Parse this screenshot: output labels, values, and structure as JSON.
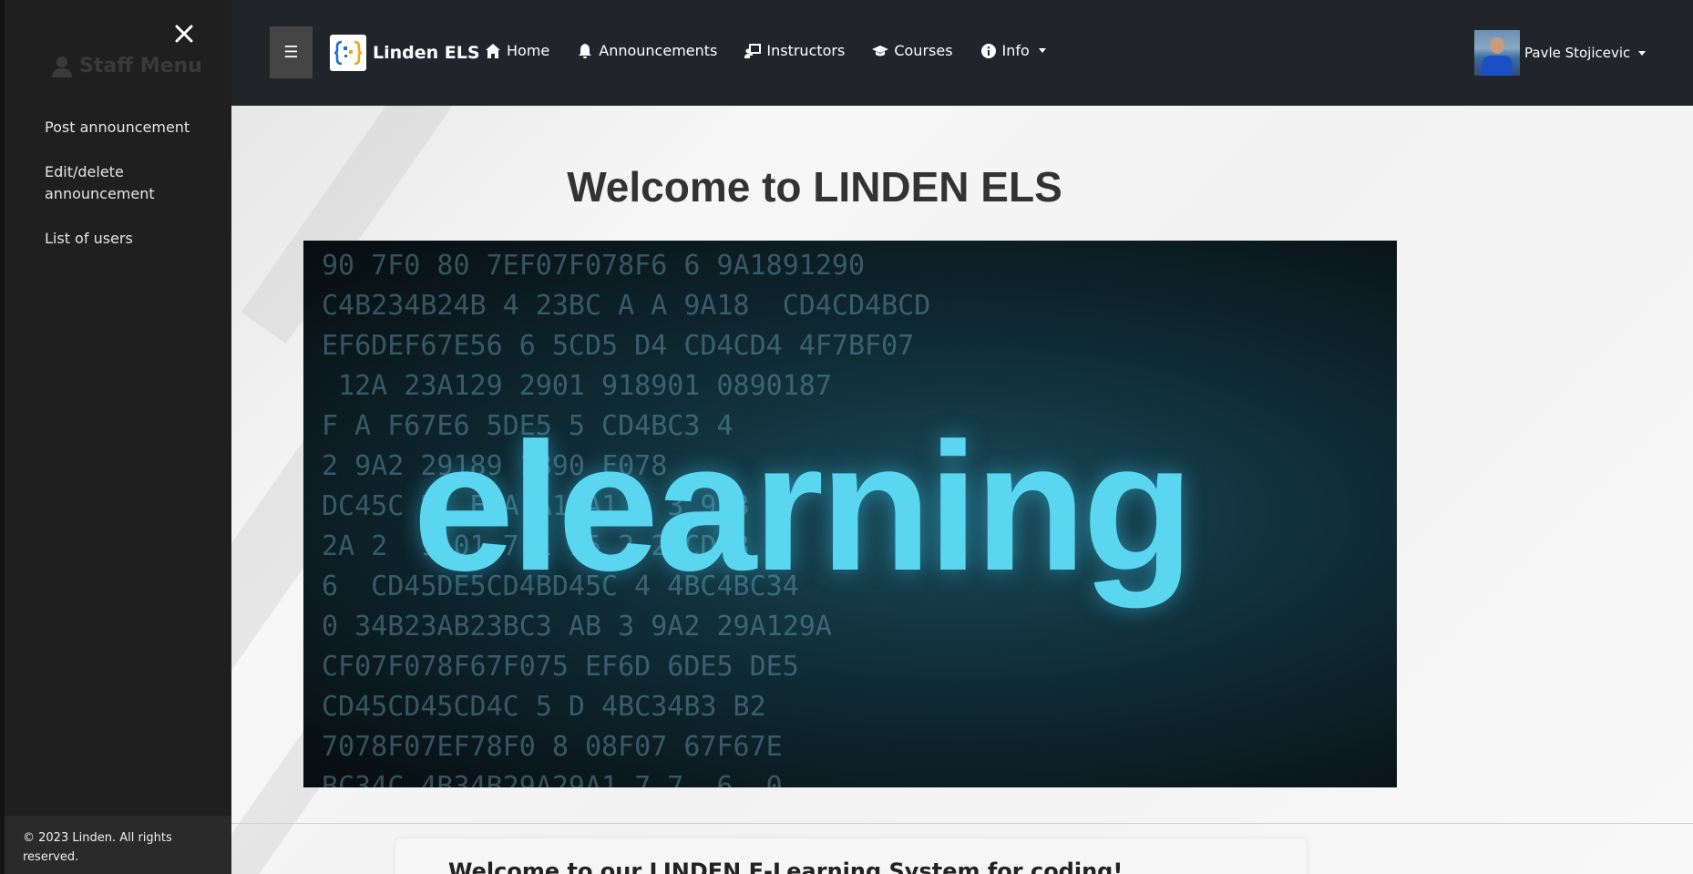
{
  "sidebar": {
    "close_icon": "close-icon",
    "title": "Staff Menu",
    "title_icon": "user-icon",
    "items": [
      {
        "label": "Post announcement"
      },
      {
        "label": "Edit/delete announcement"
      },
      {
        "label": "List of users"
      }
    ],
    "footer": "© 2023 Linden. All rights reserved."
  },
  "navbar": {
    "toggle_label": "☰",
    "brand": "Linden ELS",
    "items": [
      {
        "label": "Home",
        "icon": "home-icon"
      },
      {
        "label": "Announcements",
        "icon": "bell-icon"
      },
      {
        "label": "Instructors",
        "icon": "chalkboard-teacher-icon"
      },
      {
        "label": "Courses",
        "icon": "graduation-cap-icon"
      },
      {
        "label": "Info",
        "icon": "info-circle-icon",
        "dropdown": true
      }
    ],
    "user": {
      "name": "Pavle Stojicevic",
      "avatar": "user-avatar"
    }
  },
  "main": {
    "heading": "Welcome to LINDEN ELS",
    "hero_word": "elearning",
    "card_title": "Welcome to our LINDEN E-Learning System for coding!"
  },
  "colors": {
    "sidebar_bg": "#1f1f1f",
    "navbar_bg": "#212529",
    "hero_accent": "#5bd6f0"
  }
}
